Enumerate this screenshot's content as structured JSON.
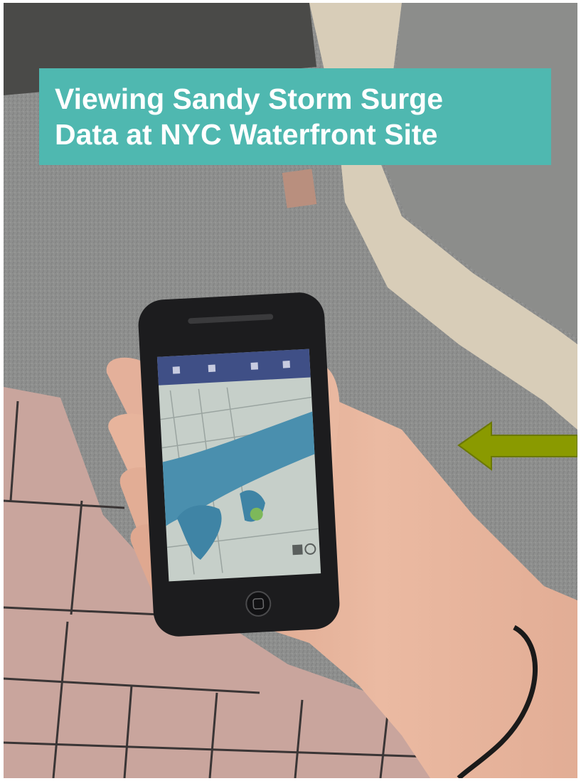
{
  "caption": {
    "line1": "Viewing Sandy Storm Surge",
    "line2": "Data at NYC Waterfront Site"
  },
  "colors": {
    "caption_bg": "#4fb8b0",
    "caption_text": "#ffffff",
    "arrow": "#8a9a00",
    "asphalt": "#8e8f8e",
    "pavers": "#c9a59d",
    "curb": "#d8cdb8",
    "skin": "#e7b49c",
    "phone": "#1c1c1e",
    "map_water": "#4a8fae",
    "map_land": "#c6cfc9"
  },
  "icons": [
    "arrow-left-icon",
    "home-button-icon"
  ]
}
